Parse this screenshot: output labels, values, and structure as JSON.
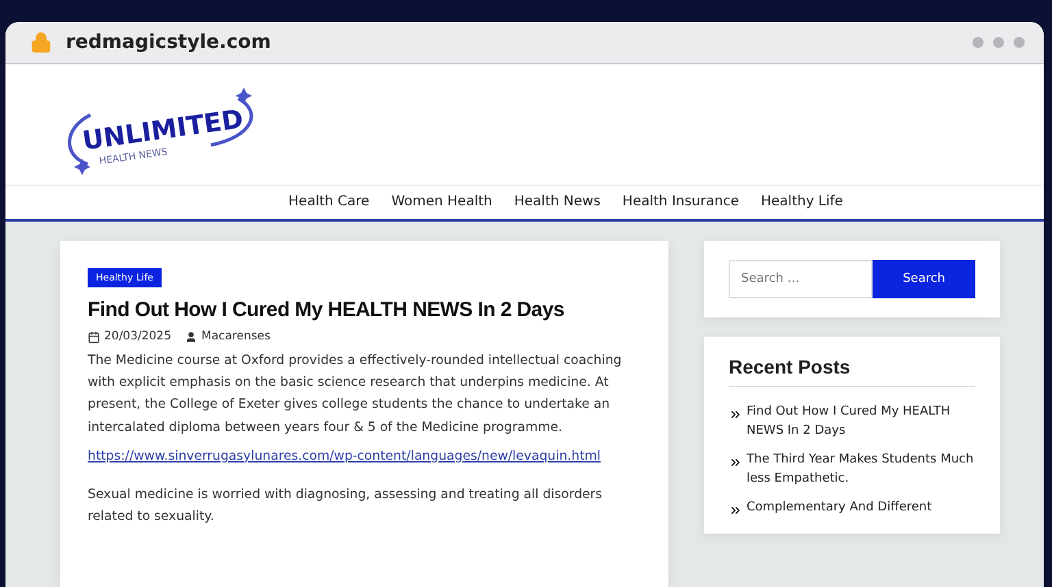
{
  "browser": {
    "url": "redmagicstyle.com"
  },
  "logo": {
    "title": "UNLIMITED",
    "subtitle": "HEALTH NEWS"
  },
  "nav": [
    {
      "label": "Health Care"
    },
    {
      "label": "Women Health"
    },
    {
      "label": "Health News"
    },
    {
      "label": "Health Insurance"
    },
    {
      "label": "Healthy Life"
    }
  ],
  "post": {
    "category": "Healthy Life",
    "title": "Find Out How I Cured My HEALTH NEWS In 2 Days",
    "date": "20/03/2025",
    "author": "Macarenses",
    "paragraphs": [
      "The Medicine course at Oxford provides a effectively-rounded intellectual coaching with explicit emphasis on the basic science research that underpins medicine. At present, the College of Exeter gives college students the chance to undertake an intercalated diploma between years four & 5 of the Medicine programme.",
      "Sexual medicine is worried with diagnosing, assessing and treating all disorders related to sexuality."
    ],
    "link": "https://www.sinverrugasylunares.com/wp-content/languages/new/levaquin.html"
  },
  "search": {
    "placeholder": "Search …",
    "button": "Search"
  },
  "recent_posts": {
    "title": "Recent Posts",
    "items": [
      "Find Out How I Cured My HEALTH NEWS In 2 Days",
      "The Third Year Makes Students Much less Empathetic.",
      "Complementary And Different"
    ]
  }
}
